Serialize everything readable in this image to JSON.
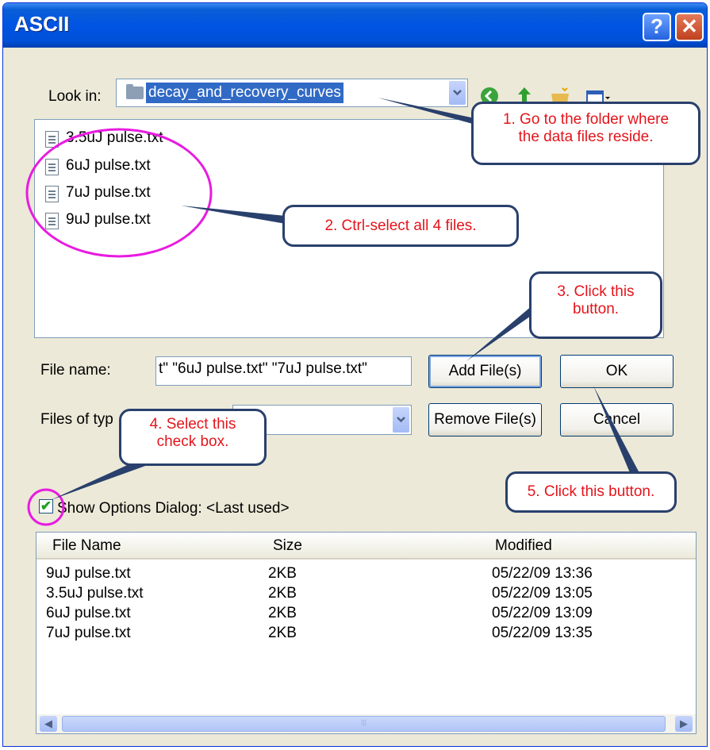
{
  "window": {
    "title": "ASCII",
    "help_glyph": "?",
    "close_glyph": "✕"
  },
  "lookin": {
    "label": "Look in:",
    "value": "decay_and_recovery_curves"
  },
  "toolbar": {
    "icons": [
      "back-icon",
      "up-folder-icon",
      "new-folder-icon",
      "view-menu-icon"
    ]
  },
  "files": [
    {
      "name": "3.5uJ pulse.txt"
    },
    {
      "name": "6uJ pulse.txt"
    },
    {
      "name": "7uJ pulse.txt"
    },
    {
      "name": "9uJ pulse.txt"
    }
  ],
  "filename": {
    "label": "File name:",
    "value": "t\" \"6uJ pulse.txt\" \"7uJ pulse.txt\""
  },
  "filetype": {
    "label": "Files of typ",
    "value": ""
  },
  "buttons": {
    "add": "Add File(s)",
    "ok": "OK",
    "remove": "Remove File(s)",
    "cancel": "Cancel"
  },
  "options": {
    "label": "Show Options Dialog: <Last used>",
    "checked": true
  },
  "list": {
    "headers": [
      "File Name",
      "Size",
      "Modified"
    ],
    "rows": [
      {
        "name": "9uJ pulse.txt",
        "size": "2KB",
        "modified": "05/22/09 13:36"
      },
      {
        "name": "3.5uJ pulse.txt",
        "size": "2KB",
        "modified": "05/22/09 13:05"
      },
      {
        "name": "6uJ pulse.txt",
        "size": "2KB",
        "modified": "05/22/09 13:09"
      },
      {
        "name": "7uJ pulse.txt",
        "size": "2KB",
        "modified": "05/22/09 13:35"
      }
    ]
  },
  "callouts": {
    "c1": {
      "line1": "1. Go to the folder where",
      "line2": "the data files reside."
    },
    "c2": {
      "line1": "2. Ctrl-select all 4 files."
    },
    "c3": {
      "line1": "3. Click this",
      "line2": "button."
    },
    "c4": {
      "line1": "4. Select this",
      "line2": "check box."
    },
    "c5": {
      "line1": "5. Click this button."
    }
  },
  "colors": {
    "titlebar": "#0054e3",
    "dialog_bg": "#ece9d8",
    "selection": "#316ac5",
    "callout_text": "#e4141b",
    "highlight_circle": "#e81be0"
  }
}
